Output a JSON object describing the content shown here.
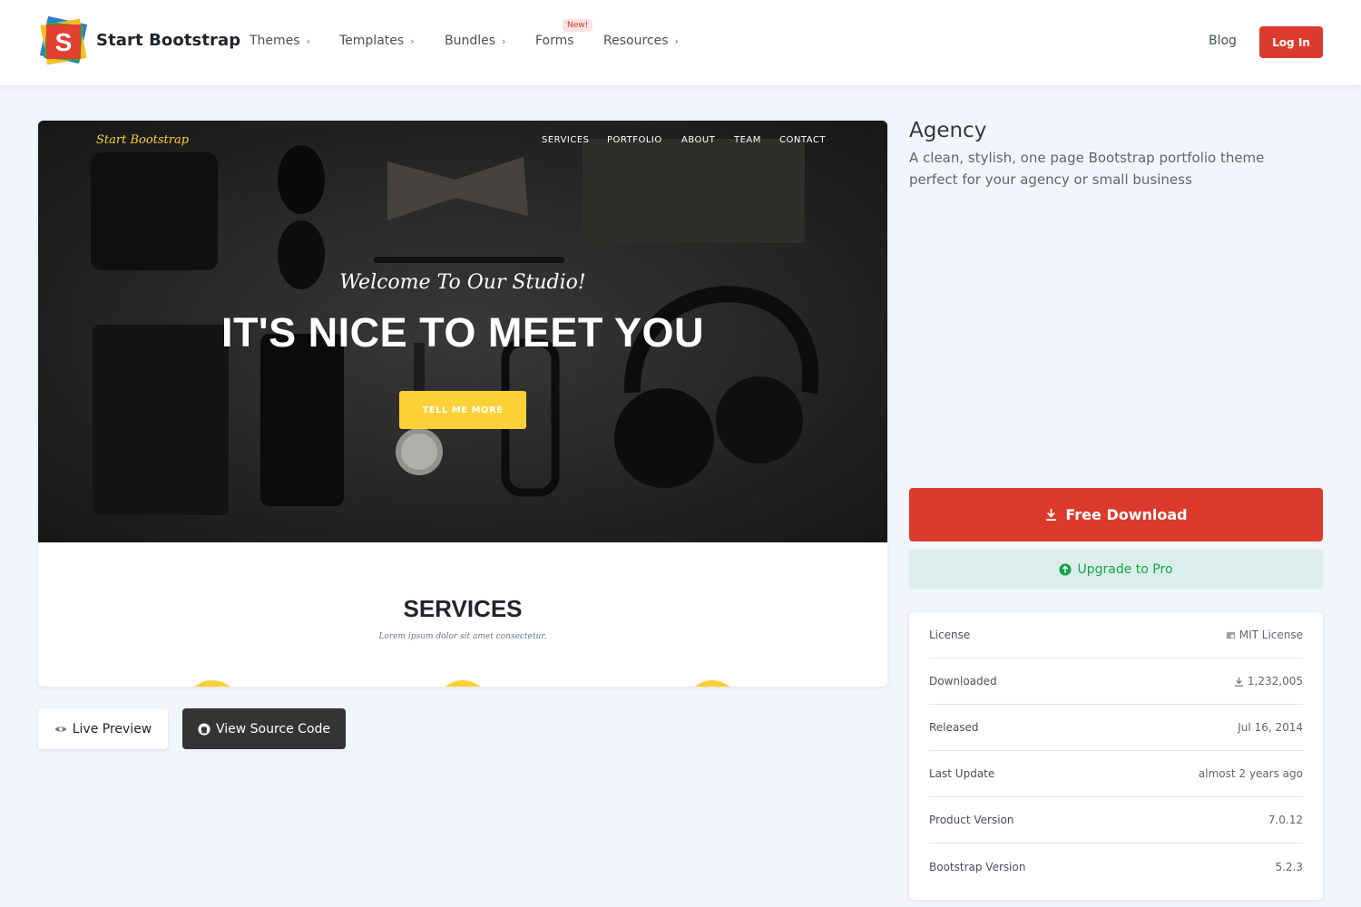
{
  "navbar": {
    "brand": "Start Bootstrap",
    "items": [
      {
        "label": "Themes",
        "chevron": true
      },
      {
        "label": "Templates",
        "chevron": true
      },
      {
        "label": "Bundles",
        "chevron": true
      },
      {
        "label": "Forms",
        "chevron": false
      },
      {
        "label": "Resources",
        "chevron": true
      }
    ],
    "new_badge": "New!",
    "blog": "Blog",
    "login": "Log In"
  },
  "preview": {
    "brand": "Start Bootstrap",
    "nav": [
      "SERVICES",
      "PORTFOLIO",
      "ABOUT",
      "TEAM",
      "CONTACT"
    ],
    "subheading": "Welcome To Our Studio!",
    "heading": "IT'S NICE TO MEET YOU",
    "cta": "TELL ME MORE",
    "services_title": "SERVICES",
    "services_sub": "Lorem ipsum dolor sit amet consectetur.",
    "accent": "#fed136"
  },
  "actions": {
    "live_preview": "Live Preview",
    "view_source": "View Source Code"
  },
  "product": {
    "title": "Agency",
    "description": "A clean, stylish, one page Bootstrap portfolio theme perfect for your agency or small business",
    "download": "Free Download",
    "upgrade": "Upgrade to Pro",
    "brand_red": "#dc3a2c",
    "pro_green": "#16a34a"
  },
  "info": [
    {
      "key": "License",
      "value": "MIT License",
      "icon": "license-icon"
    },
    {
      "key": "Downloaded",
      "value": "1,232,005",
      "icon": "download-icon"
    },
    {
      "key": "Released",
      "value": "Jul 16, 2014"
    },
    {
      "key": "Last Update",
      "value": "almost 2 years ago"
    },
    {
      "key": "Product Version",
      "value": "7.0.12"
    },
    {
      "key": "Bootstrap Version",
      "value": "5.2.3"
    }
  ]
}
